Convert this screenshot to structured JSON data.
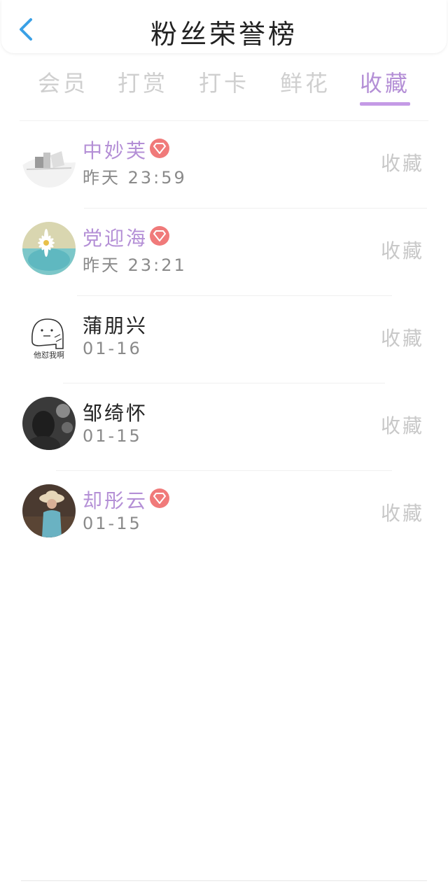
{
  "header": {
    "title": "粉丝荣誉榜"
  },
  "tabs": [
    {
      "label": "会员"
    },
    {
      "label": "打赏"
    },
    {
      "label": "打卡"
    },
    {
      "label": "鲜花"
    },
    {
      "label": "收藏",
      "active": true
    }
  ],
  "colors": {
    "accent": "#b48fd6",
    "badge": "#f07a7a",
    "back": "#3aa0e6"
  },
  "fans": [
    {
      "name": "中妙芙",
      "vip": true,
      "time": "昨天 23:59",
      "action": "收藏",
      "avatar": "sketch-landscape"
    },
    {
      "name": "党迎海",
      "vip": true,
      "time": "昨天 23:21",
      "action": "收藏",
      "avatar": "daisy-cup"
    },
    {
      "name": "蒲朋兴",
      "vip": false,
      "time": "01-16",
      "action": "收藏",
      "avatar": "cartoon-doodle",
      "avatar_caption": "他怼我啊"
    },
    {
      "name": "邹绮怀",
      "vip": false,
      "time": "01-15",
      "action": "收藏",
      "avatar": "dark-portrait"
    },
    {
      "name": "却彤云",
      "vip": true,
      "time": "01-15",
      "action": "收藏",
      "avatar": "girl-straw-hat"
    }
  ]
}
